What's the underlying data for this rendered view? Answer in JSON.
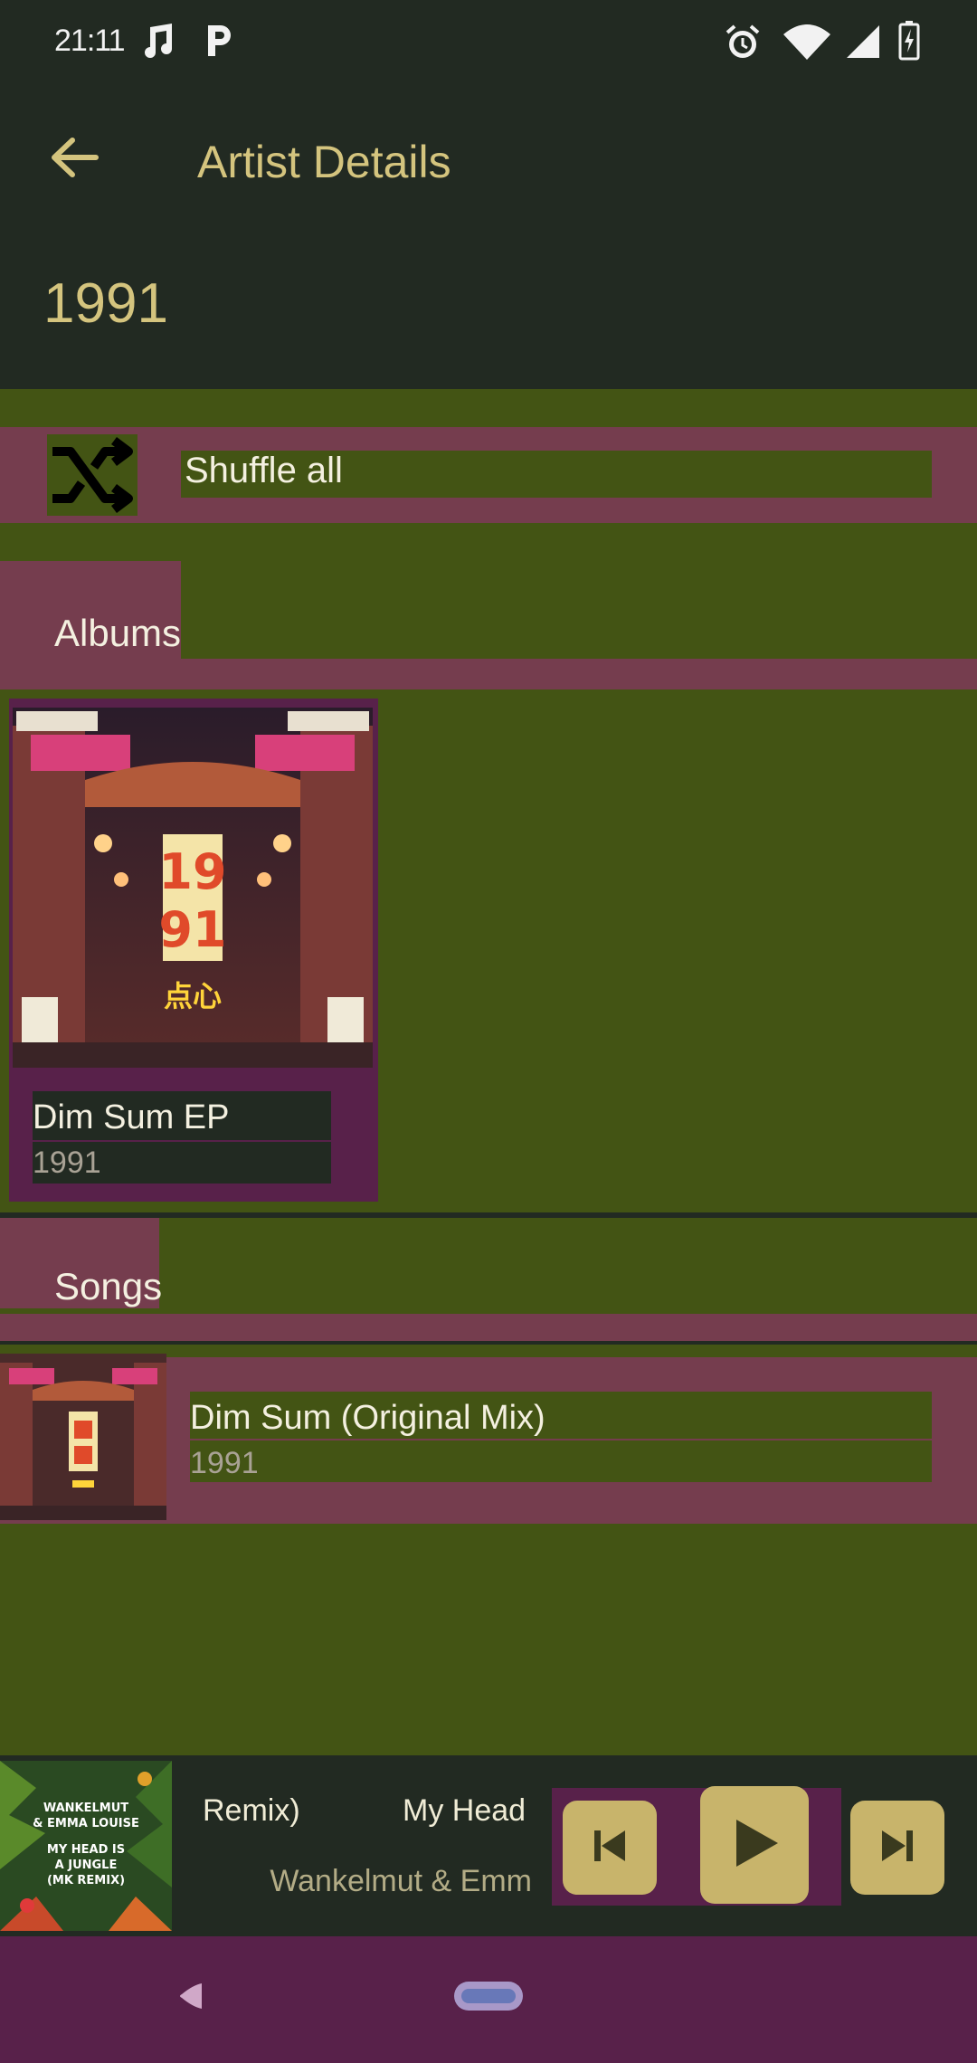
{
  "status_bar": {
    "time": "21:11",
    "icons": [
      "music-note-icon",
      "p-icon",
      "alarm-icon",
      "wifi-icon",
      "signal-icon",
      "battery-charging-icon"
    ]
  },
  "app_bar": {
    "title": "Artist Details",
    "back_icon": "arrow-left-icon"
  },
  "artist": {
    "name": "1991"
  },
  "shuffle": {
    "label": "Shuffle all",
    "icon": "shuffle-icon"
  },
  "albums": {
    "header": "Albums",
    "items": [
      {
        "title": "Dim Sum EP",
        "year": "1991",
        "art_text_top": "19",
        "art_text_bottom": "91",
        "art_caption": "点心"
      }
    ]
  },
  "songs": {
    "header": "Songs",
    "items": [
      {
        "title": "Dim Sum (Original Mix)",
        "subtitle": "1991"
      }
    ]
  },
  "mini_player": {
    "title_marquee": "Remix)            My Head",
    "artist_marquee": "Wankelmut & Emm",
    "art_lines": [
      "WANKELMUT",
      "& EMMA LOUISE",
      "MY HEAD IS",
      "A JUNGLE",
      "(MK REMIX)"
    ],
    "controls": [
      "skip-previous-icon",
      "play-icon",
      "skip-next-icon"
    ]
  },
  "colors": {
    "background": "#222a22",
    "accent": "#d4c47e",
    "section_green": "#435414",
    "card_purple": "#58214a",
    "control_gold": "#c8b46b"
  }
}
